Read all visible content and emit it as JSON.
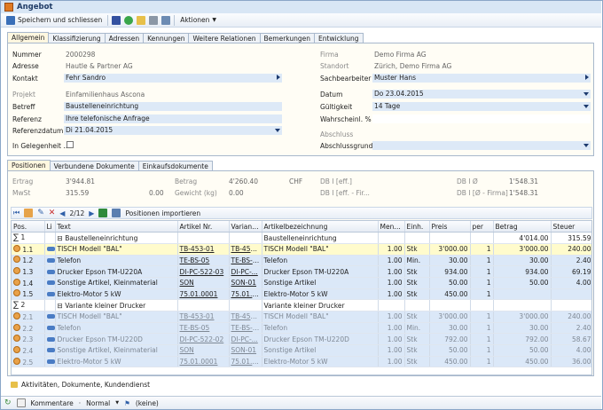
{
  "window": {
    "title": "Angebot"
  },
  "toolbar": {
    "save_close": "Speichern und schliessen",
    "actions": "Aktionen"
  },
  "tabs": [
    "Allgemein",
    "Klassifizierung",
    "Adressen",
    "Kennungen",
    "Weitere Relationen",
    "Bemerkungen",
    "Entwicklung"
  ],
  "form": {
    "nummer_label": "Nummer",
    "nummer": "2000298",
    "adresse_label": "Adresse",
    "adresse": "Hautle & Partner AG",
    "kontakt_label": "Kontakt",
    "kontakt": "Fehr Sandro",
    "projekt_label": "Projekt",
    "projekt": "Einfamilienhaus Ascona",
    "betreff_label": "Betreff",
    "betreff": "Baustelleneinrichtung",
    "referenz_label": "Referenz",
    "referenz": "Ihre telefonische Anfrage",
    "referenzdatum_label": "Referenzdatum",
    "referenzdatum": "Di 21.04.2015",
    "gelegenheit_label": "In Gelegenheit ...",
    "firma_label": "Firma",
    "firma": "Demo Firma AG",
    "standort_label": "Standort",
    "standort": "Zürich, Demo Firma AG",
    "sachbearbeiter_label": "Sachbearbeiter",
    "sachbearbeiter": "Muster Hans",
    "datum_label": "Datum",
    "datum": "Do 23.04.2015",
    "gueltigkeit_label": "Gültigkeit",
    "gueltigkeit": "14 Tage",
    "wahrscheinl_label": "Wahrscheinl. %",
    "abschluss_label": "Abschluss",
    "abschlussgrund_label": "Abschlussgrund"
  },
  "subtabs": [
    "Positionen",
    "Verbundene Dokumente",
    "Einkaufsdokumente"
  ],
  "totals": {
    "ertrag_label": "Ertrag",
    "ertrag": "3'944.81",
    "betrag_label": "Betrag",
    "betrag": "4'260.40",
    "currency": "CHF",
    "db_eff_label": "DB I [eff.]",
    "db_pct_label": "DB I Ø",
    "db_pct": "1'548.31",
    "mwst_label": "MwSt",
    "mwst": "315.59",
    "mwst2": "0.00",
    "gewicht_label": "Gewicht (kg)",
    "gewicht": "0.00",
    "db_eff2_label": "DB I [eff. - Fir...",
    "db_firma_label": "DB I [Ø - Firma]",
    "db_firma": "1'548.31"
  },
  "gridbar": {
    "pager": "2/12",
    "import": "Positionen importieren"
  },
  "columns": [
    "Pos.",
    "Li",
    "Text",
    "Artikel Nr.",
    "Variante...",
    "Artikelbezeichnung",
    "Menge",
    "Einh.",
    "Preis",
    "per",
    "Betrag",
    "Steuer"
  ],
  "rows": [
    {
      "type": "group",
      "pos": "1",
      "text": "Baustelleneinrichtung",
      "bez": "Baustelleneinrichtung",
      "betrag": "4'014.00",
      "steuer": "315.59"
    },
    {
      "type": "sel",
      "pos": "1.1",
      "text": "TISCH Modell \"BAL\"",
      "art": "TB-453-01",
      "var": "TB-453-...",
      "bez": "TISCH Modell \"BAL\"",
      "menge": "1.00",
      "einh": "Stk",
      "preis": "3'000.00",
      "per": "1",
      "betrag": "3'000.00",
      "steuer": "240.00"
    },
    {
      "type": "row",
      "pos": "1.2",
      "text": "Telefon",
      "art": "TE-BS-05",
      "var": "TE-BS-05",
      "bez": "Telefon",
      "menge": "1.00",
      "einh": "Min.",
      "preis": "30.00",
      "per": "1",
      "betrag": "30.00",
      "steuer": "2.40"
    },
    {
      "type": "row",
      "pos": "1.3",
      "text": "Drucker Epson TM-U220A",
      "art": "DI-PC-522-03",
      "var": "DI-PC-...",
      "bez": "Drucker Epson TM-U220A",
      "menge": "1.00",
      "einh": "Stk",
      "preis": "934.00",
      "per": "1",
      "betrag": "934.00",
      "steuer": "69.19"
    },
    {
      "type": "row",
      "pos": "1.4",
      "text": "Sonstige Artikel, Kleinmaterial",
      "art": "SON",
      "var": "SON-01",
      "bez": "Sonstige Artikel",
      "menge": "1.00",
      "einh": "Stk",
      "preis": "50.00",
      "per": "1",
      "betrag": "50.00",
      "steuer": "4.00"
    },
    {
      "type": "row",
      "pos": "1.5",
      "text": "Elektro-Motor 5 kW",
      "art": "75.01.0001",
      "var": "75.01.0...",
      "bez": "Elektro-Motor 5 kW",
      "menge": "1.00",
      "einh": "Stk",
      "preis": "450.00",
      "per": "1",
      "betrag": "",
      "steuer": ""
    },
    {
      "type": "group gray",
      "pos": "2",
      "text": "Variante kleiner Drucker",
      "bez": "Variante kleiner Drucker",
      "betrag": "",
      "steuer": ""
    },
    {
      "type": "row gray",
      "pos": "2.1",
      "text": "TISCH Modell \"BAL\"",
      "art": "TB-453-01",
      "var": "TB-453-...",
      "bez": "TISCH Modell \"BAL\"",
      "menge": "1.00",
      "einh": "Stk",
      "preis": "3'000.00",
      "per": "1",
      "betrag": "3'000.00",
      "steuer": "240.00"
    },
    {
      "type": "row gray",
      "pos": "2.2",
      "text": "Telefon",
      "art": "TE-BS-05",
      "var": "TE-BS-05",
      "bez": "Telefon",
      "menge": "1.00",
      "einh": "Min.",
      "preis": "30.00",
      "per": "1",
      "betrag": "30.00",
      "steuer": "2.40"
    },
    {
      "type": "row gray",
      "pos": "2.3",
      "text": "Drucker Epson TM-U220D",
      "art": "DI-PC-522-02",
      "var": "DI-PC-...",
      "bez": "Drucker Epson TM-U220D",
      "menge": "1.00",
      "einh": "Stk",
      "preis": "792.00",
      "per": "1",
      "betrag": "792.00",
      "steuer": "58.67"
    },
    {
      "type": "row gray",
      "pos": "2.4",
      "text": "Sonstige Artikel, Kleinmaterial",
      "art": "SON",
      "var": "SON-01",
      "bez": "Sonstige Artikel",
      "menge": "1.00",
      "einh": "Stk",
      "preis": "50.00",
      "per": "1",
      "betrag": "50.00",
      "steuer": "4.00"
    },
    {
      "type": "row gray",
      "pos": "2.5",
      "text": "Elektro-Motor 5 kW",
      "art": "75.01.0001",
      "var": "75.01.0...",
      "bez": "Elektro-Motor 5 kW",
      "menge": "1.00",
      "einh": "Stk",
      "preis": "450.00",
      "per": "1",
      "betrag": "450.00",
      "steuer": "36.00"
    }
  ],
  "bottom": {
    "aktivitaeten": "Aktivitäten, Dokumente, Kundendienst"
  },
  "status": {
    "kommentare": "Kommentare",
    "normal": "Normal",
    "keine": "(keine)"
  }
}
